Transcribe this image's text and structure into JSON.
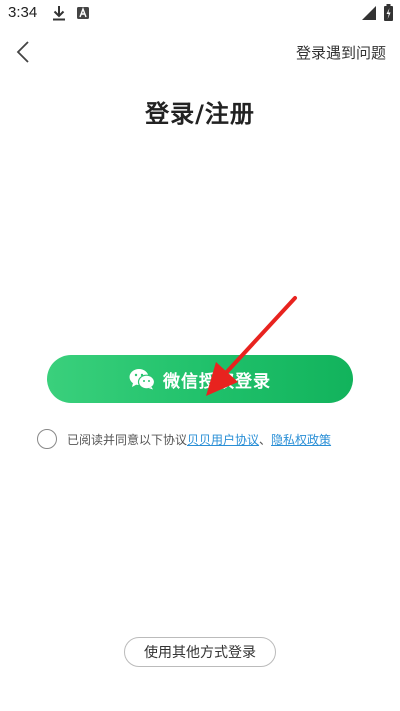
{
  "status_bar": {
    "time": "3:34",
    "icons": [
      "download-icon",
      "a-notification-icon",
      "signal-icon",
      "battery-icon"
    ]
  },
  "header": {
    "back_icon": "chevron-left-icon",
    "help_label": "登录遇到问题"
  },
  "title": "登录/注册",
  "wechat_login": {
    "icon": "wechat-icon",
    "label": "微信授权登录",
    "colors": {
      "start": "#3ad07c",
      "end": "#12b35c"
    }
  },
  "agreement": {
    "prefix": "已阅读并同意以下协议",
    "link1": "贝贝用户协议",
    "separator": "、",
    "link2": "隐私权政策",
    "link_color": "#2a8fd6"
  },
  "other_login": {
    "label": "使用其他方式登录"
  },
  "annotation": {
    "arrow_color": "#e8231f"
  }
}
